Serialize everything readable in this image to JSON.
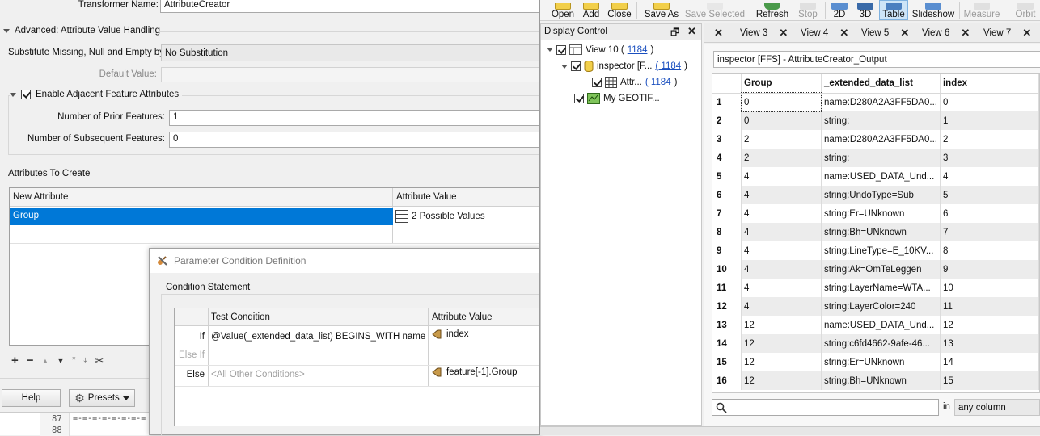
{
  "left": {
    "transformer_name_label": "Transformer Name:",
    "transformer_name_value": "AttributeCreator",
    "advanced_section": "Advanced: Attribute Value Handling",
    "substitute_label": "Substitute Missing, Null and Empty by:",
    "substitute_value": "No Substitution",
    "default_value_label": "Default Value:",
    "enable_adjacent_label": "Enable Adjacent Feature Attributes",
    "prior_label": "Number of Prior Features:",
    "prior_value": "1",
    "subsequent_label": "Number of Subsequent Features:",
    "subsequent_value": "0",
    "attributes_to_create_label": "Attributes To Create",
    "table_headers": [
      "New Attribute",
      "Attribute Value"
    ],
    "table_row": {
      "attr": "Group",
      "value": "2 Possible Values"
    },
    "help_button": "Help",
    "presets_button": "Presets",
    "line_numbers": [
      "87",
      "88"
    ],
    "code_line_87": "=-=-=-=-=-=-=-="
  },
  "dialog": {
    "title": "Parameter Condition Definition",
    "section": "Condition Statement",
    "headers": [
      "Test Condition",
      "Attribute Value"
    ],
    "rows": [
      {
        "kw": "If",
        "cond": "@Value(_extended_data_list) BEGINS_WITH name",
        "value": "index"
      },
      {
        "kw": "Else If",
        "cond": "",
        "value": ""
      },
      {
        "kw": "Else",
        "cond": "<All Other Conditions>",
        "value": "feature[-1].Group"
      }
    ]
  },
  "toolbar": {
    "open": "Open",
    "add": "Add",
    "close": "Close",
    "save_as": "Save As",
    "save_selected": "Save Selected",
    "refresh": "Refresh",
    "stop": "Stop",
    "2d": "2D",
    "3d": "3D",
    "table": "Table",
    "slideshow": "Slideshow",
    "measure": "Measure",
    "orbit": "Orbit"
  },
  "display_control": {
    "title": "Display Control",
    "items": [
      {
        "label": "View 10 (",
        "count": "1184",
        "end": ")"
      },
      {
        "label": "inspector [F...",
        "count": "( 1184",
        "end": ")"
      },
      {
        "label": "Attr...",
        "count": "( 1184",
        "end": ")"
      },
      {
        "label": "My GEOTIF..."
      }
    ]
  },
  "view_tabs": [
    "View 3",
    "View 4",
    "View 5",
    "View 6",
    "View 7"
  ],
  "data_table": {
    "source": "inspector [FFS] - AttributeCreator_Output",
    "columns": [
      "Group",
      "_extended_data_list",
      "index"
    ],
    "rows": [
      {
        "n": "1",
        "group": "0",
        "ext": "name:D280A2A3FF5DA0...",
        "index": "0"
      },
      {
        "n": "2",
        "group": "0",
        "ext": "string:",
        "index": "1"
      },
      {
        "n": "3",
        "group": "2",
        "ext": "name:D280A2A3FF5DA0...",
        "index": "2"
      },
      {
        "n": "4",
        "group": "2",
        "ext": "string:",
        "index": "3"
      },
      {
        "n": "5",
        "group": "4",
        "ext": "name:USED_DATA_Und...",
        "index": "4"
      },
      {
        "n": "6",
        "group": "4",
        "ext": "string:UndoType=Sub",
        "index": "5"
      },
      {
        "n": "7",
        "group": "4",
        "ext": "string:Er=UNknown",
        "index": "6"
      },
      {
        "n": "8",
        "group": "4",
        "ext": "string:Bh=UNknown",
        "index": "7"
      },
      {
        "n": "9",
        "group": "4",
        "ext": "string:LineType=E_10KV...",
        "index": "8"
      },
      {
        "n": "10",
        "group": "4",
        "ext": "string:Ak=OmTeLeggen",
        "index": "9"
      },
      {
        "n": "11",
        "group": "4",
        "ext": "string:LayerName=WTA...",
        "index": "10"
      },
      {
        "n": "12",
        "group": "4",
        "ext": "string:LayerColor=240",
        "index": "11"
      },
      {
        "n": "13",
        "group": "12",
        "ext": "name:USED_DATA_Und...",
        "index": "12"
      },
      {
        "n": "14",
        "group": "12",
        "ext": "string:c6fd4662-9afe-46...",
        "index": "13"
      },
      {
        "n": "15",
        "group": "12",
        "ext": "string:Er=UNknown",
        "index": "14"
      },
      {
        "n": "16",
        "group": "12",
        "ext": "string:Bh=UNknown",
        "index": "15"
      }
    ],
    "search_in_label": "in",
    "search_scope": "any column"
  },
  "colors": {
    "selection": "#0078d7",
    "link": "#1a4fbf",
    "accent_yellow": "#f2cf4a"
  }
}
